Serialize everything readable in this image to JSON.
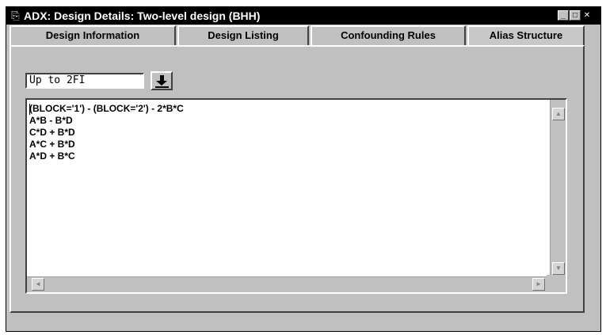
{
  "window": {
    "title": "ADX: Design Details: Two-level design (BHH)",
    "app_icon": "sas-app-icon",
    "controls": {
      "minimize": "_",
      "maximize": "□",
      "close": "✕"
    }
  },
  "tabs": [
    {
      "label": "Design Information",
      "active": false
    },
    {
      "label": "Design Listing",
      "active": false
    },
    {
      "label": "Confounding Rules",
      "active": false
    },
    {
      "label": "Alias Structure",
      "active": true
    }
  ],
  "alias_filter": {
    "selected": "Up to 2FI",
    "dropdown_icon": "down-arrow-icon"
  },
  "alias_text": {
    "lines": [
      "(BLOCK='1') - (BLOCK='2') - 2*B*C",
      "A*B - B*D",
      "C*D + B*D",
      "A*C + B*D",
      "A*D + B*C"
    ]
  },
  "scrollbars": {
    "up": "▲",
    "down": "▼",
    "left": "◄",
    "right": "►"
  }
}
